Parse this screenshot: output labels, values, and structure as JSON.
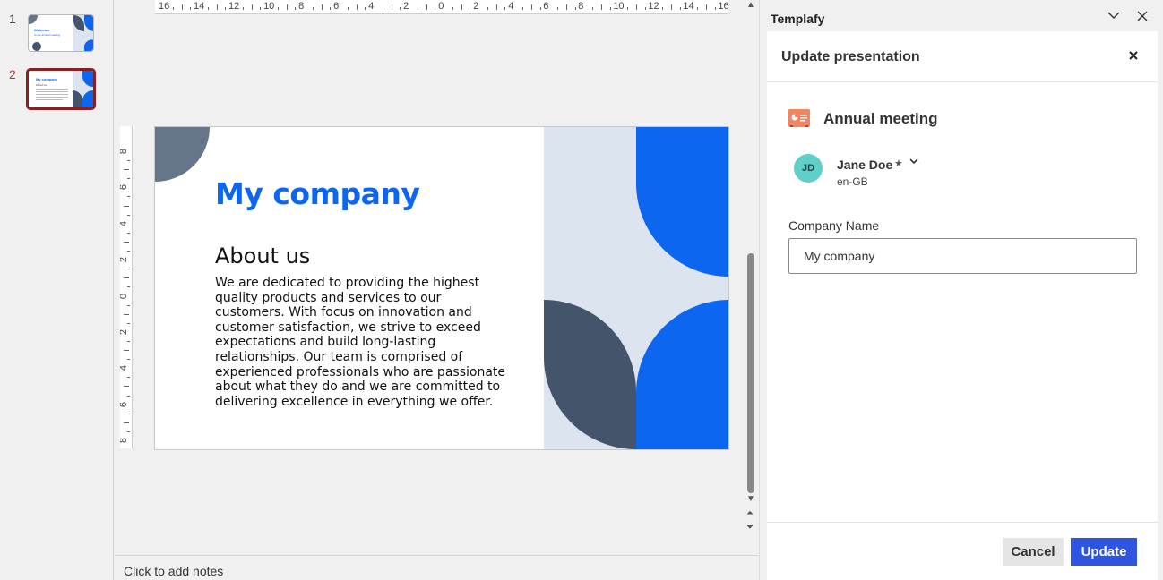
{
  "thumbnails": [
    {
      "number": "1",
      "selected": false,
      "title": "Welcome",
      "subtitle": "to our annual meeting"
    },
    {
      "number": "2",
      "selected": true,
      "title": "My company",
      "subtitle": "About us"
    }
  ],
  "ruler": {
    "horizontal_ticks": [
      "16",
      "14",
      "12",
      "10",
      "8",
      "6",
      "4",
      "2",
      "0",
      "2",
      "4",
      "6",
      "8",
      "10",
      "12",
      "14",
      "16"
    ],
    "vertical_ticks": [
      "8",
      "6",
      "4",
      "2",
      "0",
      "2",
      "4",
      "6",
      "8"
    ]
  },
  "slide": {
    "title": "My company",
    "heading": "About us",
    "body": "We are dedicated to providing the highest quality products and services to our customers. With focus on innovation and customer satisfaction, we strive to exceed expectations and build long-lasting relationships. Our team is comprised of experienced professionals who are passionate about what they do and we are committed to delivering excellence in everything we offer.",
    "colors": {
      "title": "#0d66f0",
      "blue": "#0d66f0",
      "slate": "#44546a",
      "slate_light": "#66768a",
      "panel_bg": "#dbe4ef"
    }
  },
  "notes": {
    "placeholder": "Click to add notes"
  },
  "templafy": {
    "app_title": "Templafy",
    "collapse_icon": "chevron-down-icon",
    "close_icon": "close-icon",
    "panel_title": "Update presentation",
    "document_name": "Annual meeting",
    "document_icon": "powerpoint-icon",
    "profile": {
      "initials": "JD",
      "name": "Jane Doe",
      "star": "★",
      "chevron": "⌄",
      "locale": "en-GB"
    },
    "field": {
      "label": "Company Name",
      "value": "My company"
    },
    "buttons": {
      "cancel": "Cancel",
      "update": "Update"
    },
    "accent_color": "#2f55e0"
  }
}
